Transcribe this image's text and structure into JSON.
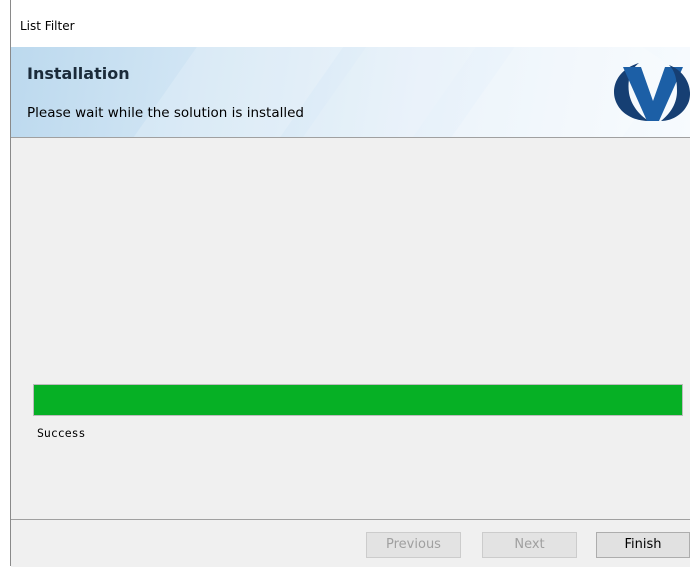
{
  "window": {
    "title": "List Filter"
  },
  "banner": {
    "heading": "Installation",
    "subheading": "Please wait while the solution is installed",
    "logo_icon": "v-logo-icon",
    "colors": {
      "logo_blue": "#1c5fa6",
      "logo_dark": "#163f73"
    }
  },
  "progress": {
    "value_percent": 100,
    "status_text": "Success",
    "fill_color": "#06b025"
  },
  "footer": {
    "previous_label": "Previous",
    "next_label": "Next",
    "finish_label": "Finish"
  }
}
